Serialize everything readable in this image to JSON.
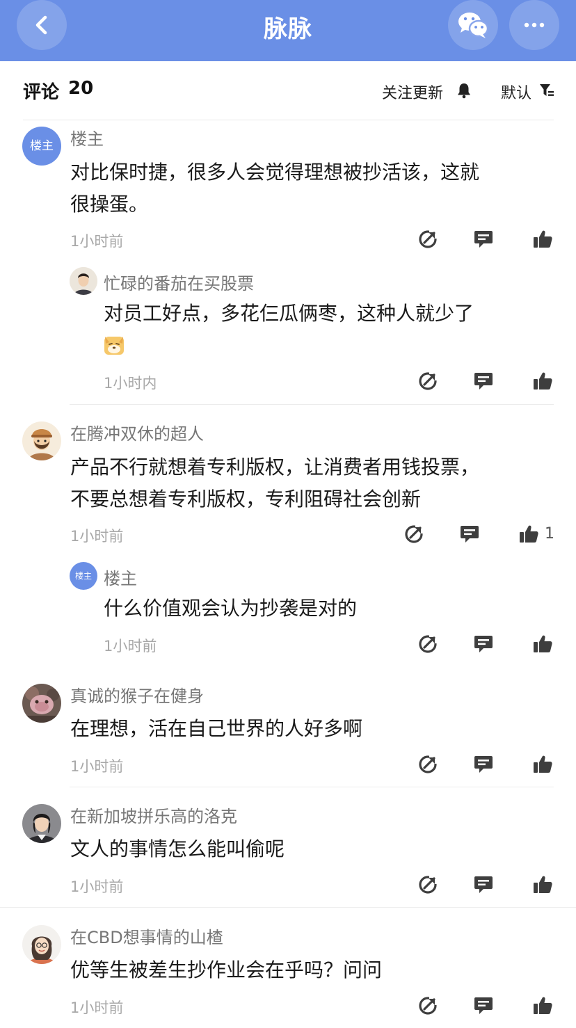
{
  "nav": {
    "title": "脉脉"
  },
  "header": {
    "comments_label": "评论",
    "comments_count": "20",
    "follow_label": "关注更新",
    "sort_label": "默认"
  },
  "avatars": {
    "host_badge": "楼主"
  },
  "comments": [
    {
      "author": "楼主",
      "text_lines": [
        "对比保时捷，很多人会觉得理想被抄活该，这就",
        "很操蛋。"
      ],
      "time": "1小时前",
      "replies": [
        {
          "author": "忙碌的番茄在买股票",
          "text_lines": [
            "对员工好点，多花仨瓜俩枣，这种人就少了"
          ],
          "emoji": "dog-emoji",
          "time": "1小时内"
        }
      ]
    },
    {
      "author": "在腾冲双休的超人",
      "text_lines": [
        "产品不行就想着专利版权，让消费者用钱投票，",
        "不要总想着专利版权，专利阻碍社会创新"
      ],
      "time": "1小时前",
      "like_count": "1",
      "replies": [
        {
          "author": "楼主",
          "text_lines": [
            "什么价值观会认为抄袭是对的"
          ],
          "time": "1小时前"
        }
      ]
    },
    {
      "author": "真诚的猴子在健身",
      "text_lines": [
        "在理想，活在自己世界的人好多啊"
      ],
      "time": "1小时前"
    },
    {
      "author": "在新加坡拼乐高的洛克",
      "text_lines": [
        "文人的事情怎么能叫偷呢"
      ],
      "time": "1小时前"
    },
    {
      "author": "在CBD想事情的山楂",
      "text_lines": [
        "优等生被差生抄作业会在乎吗？问问"
      ],
      "time": "1小时前"
    }
  ],
  "icons": {
    "back": "chevron-left-icon",
    "wechat": "wechat-icon",
    "more": "more-dots-icon",
    "bell": "bell-icon",
    "filter": "filter-icon",
    "share": "share-icon",
    "reply": "comment-icon",
    "like": "thumbs-up-icon"
  },
  "colors": {
    "accent": "#6a8fe6",
    "muted": "#a8a8a8",
    "text": "#1a1a1a"
  }
}
